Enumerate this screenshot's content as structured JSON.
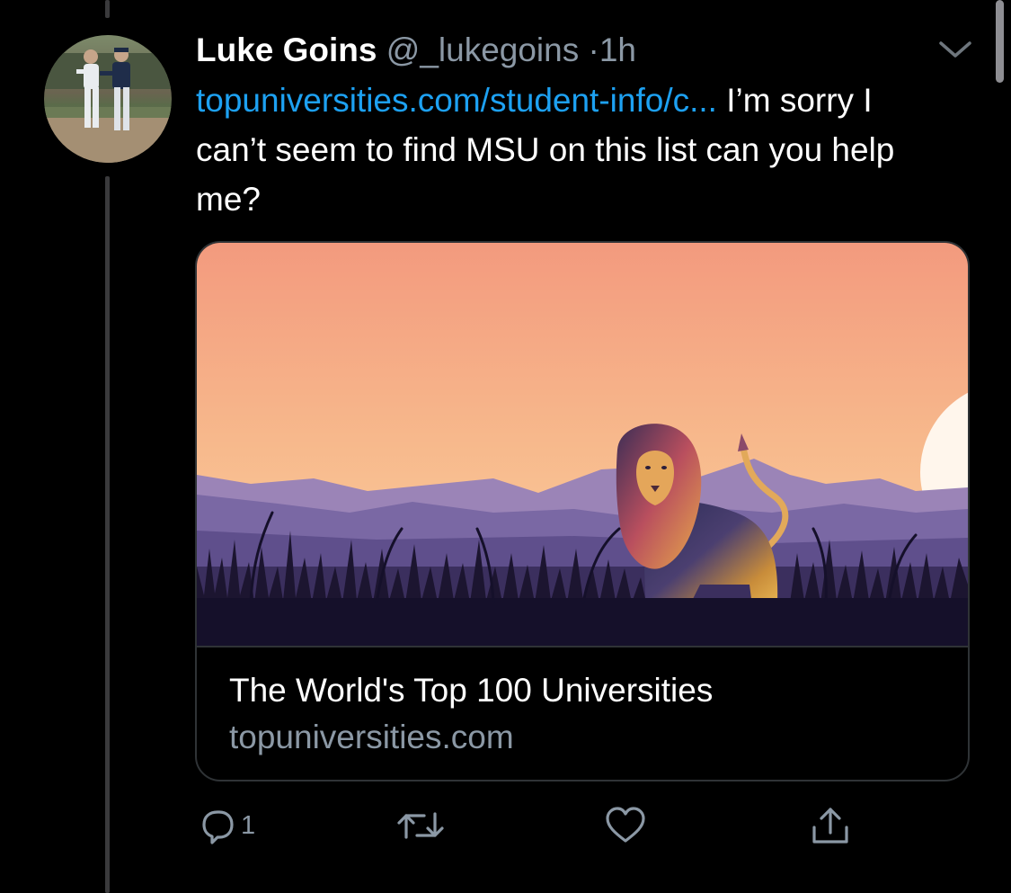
{
  "tweet": {
    "author_name": "Luke Goins",
    "handle": "@_lukegoins",
    "separator": "·",
    "time": "1h",
    "link_text": "topuniversities.com/student-info/c...",
    "text": " I’m sorry I can’t seem to find MSU on this list can you help me?"
  },
  "card": {
    "title": "The World's Top 100 Universities",
    "domain": "topuniversities.com"
  },
  "actions": {
    "reply_count": "1",
    "icons": [
      "reply-icon",
      "retweet-icon",
      "like-icon",
      "share-icon"
    ]
  },
  "colors": {
    "background": "#000000",
    "link": "#1da1f2",
    "secondary_text": "#8b98a5",
    "border": "#2f3336"
  }
}
